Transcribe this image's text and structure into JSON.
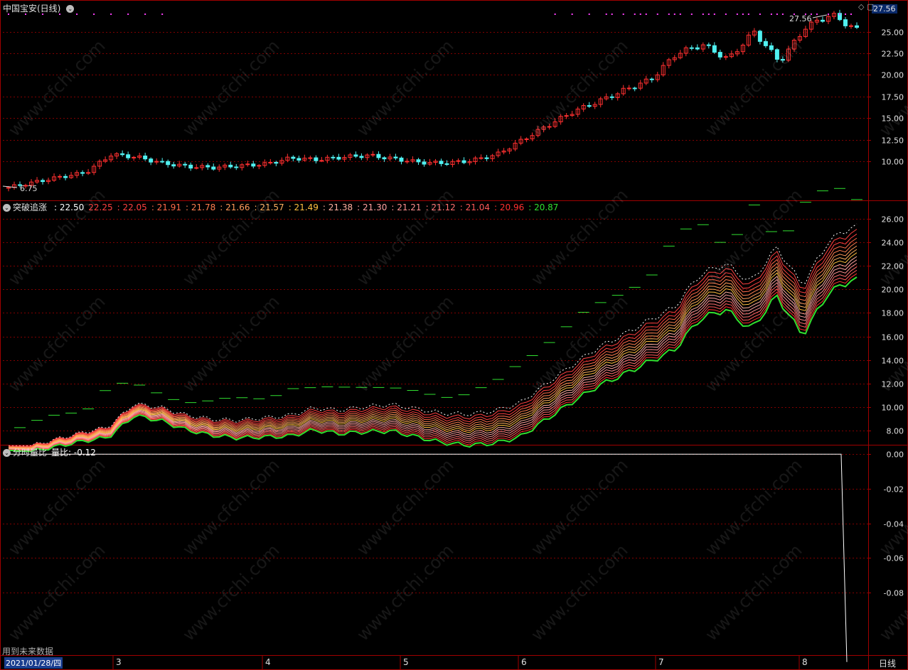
{
  "panel1": {
    "title": "中国宝安(日线)",
    "right_price": "27.56",
    "high_label": "27.56",
    "low_label": "6.75"
  },
  "panel2": {
    "title": "突破追涨",
    "values": [
      {
        "text": ": 22.50",
        "color": "#ffffff"
      },
      {
        "text": "22.25",
        "color": "#ff4040"
      },
      {
        "text": ": 22.05",
        "color": "#ff4040"
      },
      {
        "text": ": 21.91",
        "color": "#ff6a4a"
      },
      {
        "text": ": 21.78",
        "color": "#ff7f50"
      },
      {
        "text": ": 21.66",
        "color": "#ff9a5a"
      },
      {
        "text": ": 21.57",
        "color": "#ffb060"
      },
      {
        "text": ": 21.49",
        "color": "#ffc040"
      },
      {
        "text": ": 21.38",
        "color": "#ffb0a0"
      },
      {
        "text": ": 21.30",
        "color": "#ffa0a0"
      },
      {
        "text": ": 21.21",
        "color": "#ff9090"
      },
      {
        "text": ": 21.12",
        "color": "#ff7070"
      },
      {
        "text": ": 21.04",
        "color": "#ff5a5a"
      },
      {
        "text": ": 20.96",
        "color": "#ff3030"
      },
      {
        "text": ": 20.87",
        "color": "#30e030"
      }
    ]
  },
  "panel3": {
    "title": "分时量比",
    "label": "量比: -0.12",
    "note": "用到未来数据"
  },
  "xaxis": {
    "date_box": "2021/01/28/四",
    "months": [
      "3",
      "4",
      "5",
      "6",
      "7",
      "8"
    ],
    "period": "日线"
  },
  "watermark": "www.cfchi.com",
  "chart_data": [
    {
      "type": "candlestick",
      "title": "中国宝安(日线)",
      "y_ticks": [
        10.0,
        12.5,
        15.0,
        17.5,
        20.0,
        22.5,
        25.0
      ],
      "ylim": [
        5.5,
        28.5
      ],
      "high": 27.56,
      "low": 6.75,
      "key_closes": [
        7.0,
        7.6,
        8.2,
        8.7,
        10.8,
        10.5,
        9.8,
        9.4,
        9.3,
        9.5,
        9.7,
        10.4,
        10.2,
        10.5,
        10.7,
        10.3,
        9.9,
        9.8,
        10.1,
        10.8,
        12.5,
        14.2,
        15.8,
        17.0,
        18.3,
        19.5,
        22.5,
        23.5,
        21.8,
        25.0,
        21.5,
        25.5,
        27.0,
        25.2
      ]
    },
    {
      "type": "line",
      "title": "突破追涨",
      "y_ticks": [
        8.0,
        10.0,
        12.0,
        14.0,
        16.0,
        18.0,
        20.0,
        22.0,
        24.0,
        26.0
      ],
      "ylim": [
        6.8,
        27.5
      ],
      "series": [
        {
          "name": "",
          "values": [
            22.5
          ]
        },
        {
          "name": "",
          "values": [
            22.25
          ]
        },
        {
          "name": "",
          "values": [
            22.05
          ]
        },
        {
          "name": "",
          "values": [
            21.91
          ]
        },
        {
          "name": "",
          "values": [
            21.78
          ]
        },
        {
          "name": "",
          "values": [
            21.66
          ]
        },
        {
          "name": "",
          "values": [
            21.57
          ]
        },
        {
          "name": "",
          "values": [
            21.49
          ]
        },
        {
          "name": "",
          "values": [
            21.38
          ]
        },
        {
          "name": "",
          "values": [
            21.3
          ]
        },
        {
          "name": "",
          "values": [
            21.21
          ]
        },
        {
          "name": "",
          "values": [
            21.12
          ]
        },
        {
          "name": "",
          "values": [
            21.04
          ]
        },
        {
          "name": "",
          "values": [
            20.96
          ]
        },
        {
          "name": "",
          "values": [
            20.87
          ]
        }
      ]
    },
    {
      "type": "line",
      "title": "分时量比",
      "y_ticks": [
        0.0,
        -0.02,
        -0.04,
        -0.06,
        -0.08
      ],
      "ylim": [
        -0.116,
        0.005
      ],
      "series": [
        {
          "name": "量比",
          "last": -0.12
        }
      ]
    }
  ],
  "colors": {
    "up": "#ff3030",
    "down": "#50f0f0",
    "grid": "#800000",
    "border": "#a00000"
  }
}
